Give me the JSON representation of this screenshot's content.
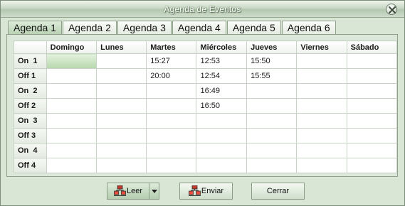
{
  "window": {
    "title": "Agenda de Eventos",
    "close_icon": "close-icon"
  },
  "tabs": [
    {
      "label": "Agenda 1"
    },
    {
      "label": "Agenda 2"
    },
    {
      "label": "Agenda 3"
    },
    {
      "label": "Agenda 4"
    },
    {
      "label": "Agenda 5"
    },
    {
      "label": "Agenda 6"
    }
  ],
  "active_tab": 0,
  "table": {
    "columns": [
      "",
      "Domingo",
      "Lunes",
      "Martes",
      "Miércoles",
      "Jueves",
      "Viernes",
      "Sábado"
    ],
    "rows": [
      {
        "label": "On  1",
        "cells": [
          "",
          "",
          "15:27",
          "12:53",
          "15:50",
          "",
          ""
        ]
      },
      {
        "label": "Off 1",
        "cells": [
          "",
          "",
          "20:00",
          "12:54",
          "15:55",
          "",
          ""
        ]
      },
      {
        "label": "On  2",
        "cells": [
          "",
          "",
          "",
          "16:49",
          "",
          "",
          ""
        ]
      },
      {
        "label": "Off 2",
        "cells": [
          "",
          "",
          "",
          "16:50",
          "",
          "",
          ""
        ]
      },
      {
        "label": "On  3",
        "cells": [
          "",
          "",
          "",
          "",
          "",
          "",
          ""
        ]
      },
      {
        "label": "Off 3",
        "cells": [
          "",
          "",
          "",
          "",
          "",
          "",
          ""
        ]
      },
      {
        "label": "On  4",
        "cells": [
          "",
          "",
          "",
          "",
          "",
          "",
          ""
        ]
      },
      {
        "label": "Off 4",
        "cells": [
          "",
          "",
          "",
          "",
          "",
          "",
          ""
        ]
      }
    ],
    "selected_cell": {
      "row": 0,
      "col": 0
    }
  },
  "buttons": {
    "leer": {
      "label": "Leer",
      "icon": "network-read-icon"
    },
    "leer_menu": {
      "icon": "dropdown-arrow-icon"
    },
    "enviar": {
      "label": "Enviar",
      "icon": "network-send-icon"
    },
    "cerrar": {
      "label": "Cerrar"
    }
  },
  "colors": {
    "window_bg": "#d9e6d6",
    "selected_cell": "#b6d7ac",
    "title_text": "#ffffff"
  }
}
